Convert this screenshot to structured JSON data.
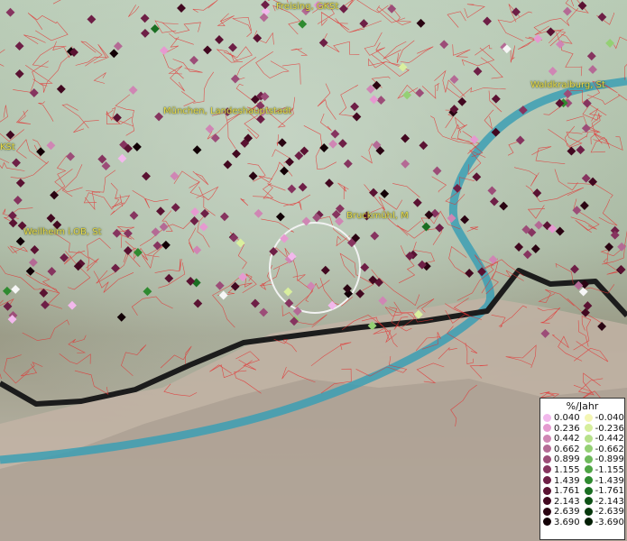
{
  "map": {
    "places": [
      {
        "name": "Freising, GKSt"
      },
      {
        "name": "Waldkraiburg, St"
      },
      {
        "name": "München, Landeshauptstadt"
      },
      {
        "name": "KSt"
      },
      {
        "name": "Bruckmühl, M"
      },
      {
        "name": "Weilheim i.OB, St"
      }
    ]
  },
  "legend": {
    "title": "%/Jahr",
    "positive": [
      {
        "label": "0.040",
        "color": "#f2b8ec"
      },
      {
        "label": "0.236",
        "color": "#e59ad0"
      },
      {
        "label": "0.442",
        "color": "#cf86b4"
      },
      {
        "label": "0.662",
        "color": "#b46a95"
      },
      {
        "label": "0.899",
        "color": "#9c4d78"
      },
      {
        "label": "1.155",
        "color": "#86345f"
      },
      {
        "label": "1.439",
        "color": "#6e1f46"
      },
      {
        "label": "1.761",
        "color": "#5a1232"
      },
      {
        "label": "2.143",
        "color": "#420820"
      },
      {
        "label": "2.639",
        "color": "#2a0412"
      },
      {
        "label": "3.690",
        "color": "#120006"
      }
    ],
    "negative": [
      {
        "label": "-0.040",
        "color": "#f4f6b4"
      },
      {
        "label": "-0.236",
        "color": "#d6ee9c"
      },
      {
        "label": "-0.442",
        "color": "#b6e08a"
      },
      {
        "label": "-0.662",
        "color": "#94d074"
      },
      {
        "label": "-0.899",
        "color": "#6fba5c"
      },
      {
        "label": "-1.155",
        "color": "#4ea444"
      },
      {
        "label": "-1.439",
        "color": "#2f8a30"
      },
      {
        "label": "-1.761",
        "color": "#1a6e22"
      },
      {
        "label": "-2.143",
        "color": "#0e5216"
      },
      {
        "label": "-2.639",
        "color": "#06380c"
      },
      {
        "label": "-3.690",
        "color": "#021e04"
      }
    ]
  }
}
